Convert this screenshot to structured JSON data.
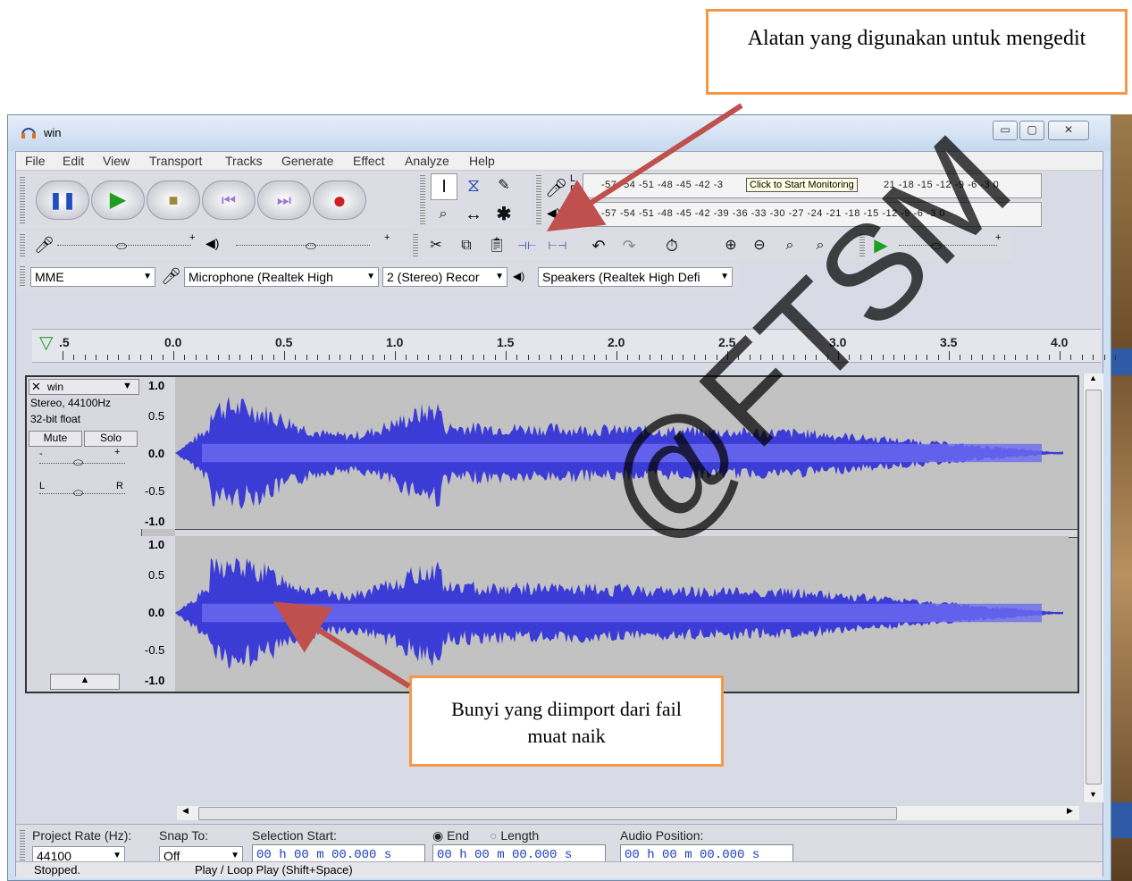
{
  "callout_top": "Alatan yang digunakan untuk mengedit",
  "callout_bottom": "Bunyi yang diimport dari fail muat naik",
  "watermark": "@FTSM",
  "window": {
    "title": "win",
    "minimize": "▭",
    "maximize": "▢",
    "close": "✕"
  },
  "menu": [
    "File",
    "Edit",
    "View",
    "Transport",
    "Tracks",
    "Generate",
    "Effect",
    "Analyze",
    "Help"
  ],
  "meter": {
    "rec_scale": "-57 -54 -51 -48 -45 -42 -3",
    "rec_scale_end": "21 -18 -15 -12 -9 -6 -3 0",
    "play_scale": "-57 -54 -51 -48 -45 -42 -39 -36 -33 -30 -27 -24 -21 -18 -15 -12 -9 -6 -3 0",
    "monitor_tooltip": "Click to Start Monitoring",
    "L": "L",
    "R": "R"
  },
  "device": {
    "host": "MME",
    "input": "Microphone (Realtek High",
    "channels": "2 (Stereo) Recor",
    "output": "Speakers (Realtek High Defi"
  },
  "ruler_labels": [
    ".5",
    "0.0",
    "0.5",
    "1.0",
    "1.5",
    "2.0",
    "2.5",
    "3.0",
    "3.5",
    "4.0"
  ],
  "track": {
    "name": "win",
    "info1": "Stereo, 44100Hz",
    "info2": "32-bit float",
    "mute": "Mute",
    "solo": "Solo",
    "gain_minus": "-",
    "gain_plus": "+",
    "pan_l": "L",
    "pan_r": "R",
    "scale": [
      "1.0",
      "0.5",
      "0.0",
      "-0.5",
      "-1.0"
    ]
  },
  "bottom": {
    "project_rate_label": "Project Rate (Hz):",
    "project_rate": "44100",
    "snap_label": "Snap To:",
    "snap_value": "Off",
    "selection_start_label": "Selection Start:",
    "end_label": "End",
    "length_label": "Length",
    "audio_position_label": "Audio Position:",
    "time_value": "00 h 00 m 00.000 s"
  },
  "status": {
    "state": "Stopped.",
    "hint": "Play / Loop Play (Shift+Space)"
  },
  "colors": {
    "waveform": "#3b3bd6",
    "waveform_light": "#6c6cf0",
    "callout_border": "#f79646",
    "arrow": "#c0504d"
  }
}
